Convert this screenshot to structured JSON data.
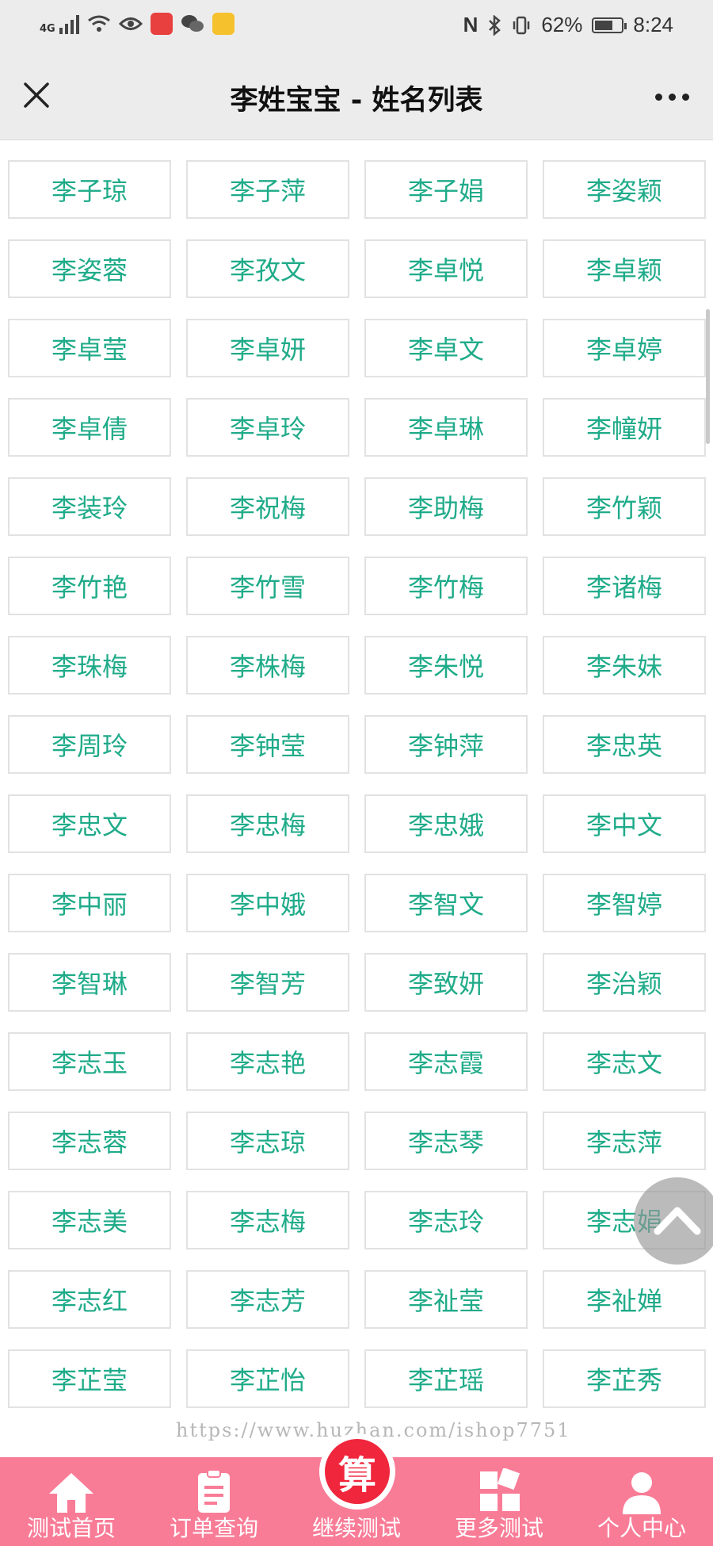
{
  "status_bar": {
    "network": "4G",
    "battery_percent": "62%",
    "time": "8:24"
  },
  "nav": {
    "title": "李姓宝宝 - 姓名列表"
  },
  "names": [
    "李子琼",
    "李子萍",
    "李子娟",
    "李姿颖",
    "李姿蓉",
    "李孜文",
    "李卓悦",
    "李卓颖",
    "李卓莹",
    "李卓妍",
    "李卓文",
    "李卓婷",
    "李卓倩",
    "李卓玲",
    "李卓琳",
    "李幢妍",
    "李装玲",
    "李祝梅",
    "李助梅",
    "李竹颖",
    "李竹艳",
    "李竹雪",
    "李竹梅",
    "李诸梅",
    "李珠梅",
    "李株梅",
    "李朱悦",
    "李朱妹",
    "李周玲",
    "李钟莹",
    "李钟萍",
    "李忠英",
    "李忠文",
    "李忠梅",
    "李忠娥",
    "李中文",
    "李中丽",
    "李中娥",
    "李智文",
    "李智婷",
    "李智琳",
    "李智芳",
    "李致妍",
    "李治颖",
    "李志玉",
    "李志艳",
    "李志霞",
    "李志文",
    "李志蓉",
    "李志琼",
    "李志琴",
    "李志萍",
    "李志美",
    "李志梅",
    "李志玲",
    "李志娟",
    "李志红",
    "李志芳",
    "李祉莹",
    "李祉婵",
    "李芷莹",
    "李芷怡",
    "李芷瑶",
    "李芷秀"
  ],
  "watermark": "https://www.huzhan.com/ishop7751",
  "tabbar": {
    "center_badge": "算",
    "tabs": [
      {
        "label": "测试首页",
        "icon": "home-icon"
      },
      {
        "label": "订单查询",
        "icon": "clipboard-icon"
      },
      {
        "label": "继续测试",
        "icon": "calculate-icon"
      },
      {
        "label": "更多测试",
        "icon": "grid-icon"
      },
      {
        "label": "个人中心",
        "icon": "user-icon"
      }
    ]
  }
}
